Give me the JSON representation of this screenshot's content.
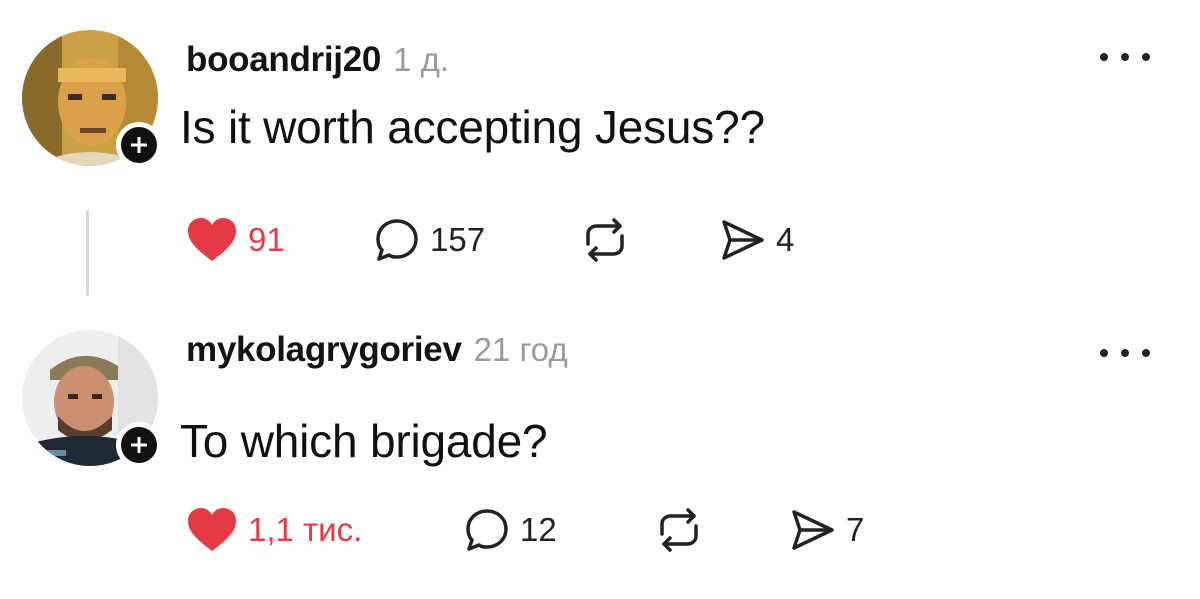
{
  "posts": [
    {
      "username": "booandrij20",
      "time": "1 д.",
      "text": "Is it worth accepting Jesus??",
      "likes": "91",
      "replies": "157",
      "shares": "4"
    },
    {
      "username": "mykolagrygoriev",
      "time": "21 год",
      "text": "To which brigade?",
      "likes": "1,1 тис.",
      "replies": "12",
      "shares": "7"
    }
  ],
  "colors": {
    "like": "#e63946",
    "muted": "#9a9a9a",
    "text": "#111111"
  },
  "icons": {
    "like": "heart-icon",
    "reply": "comment-icon",
    "repost": "repost-icon",
    "share": "send-icon",
    "more": "more-dots-icon",
    "follow": "plus-icon"
  }
}
